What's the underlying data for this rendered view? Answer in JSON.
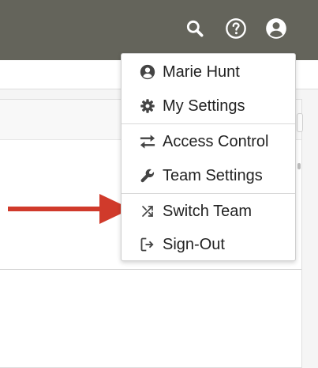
{
  "header": {
    "icons": [
      "search-icon",
      "help-icon",
      "account-icon"
    ],
    "icon_color": "#ffffff",
    "background": "#64645b"
  },
  "user_menu": {
    "items": [
      {
        "label": "Marie Hunt",
        "icon": "user-circle-icon"
      },
      {
        "label": "My Settings",
        "icon": "gear-icon"
      },
      {
        "label": "Access Control",
        "icon": "swap-arrows-icon"
      },
      {
        "label": "Team Settings",
        "icon": "wrench-icon"
      },
      {
        "label": "Switch Team",
        "icon": "shuffle-icon"
      },
      {
        "label": "Sign-Out",
        "icon": "sign-out-icon"
      }
    ]
  },
  "annotation": {
    "arrow_color": "#d03a2b",
    "points_to": "Switch Team"
  }
}
